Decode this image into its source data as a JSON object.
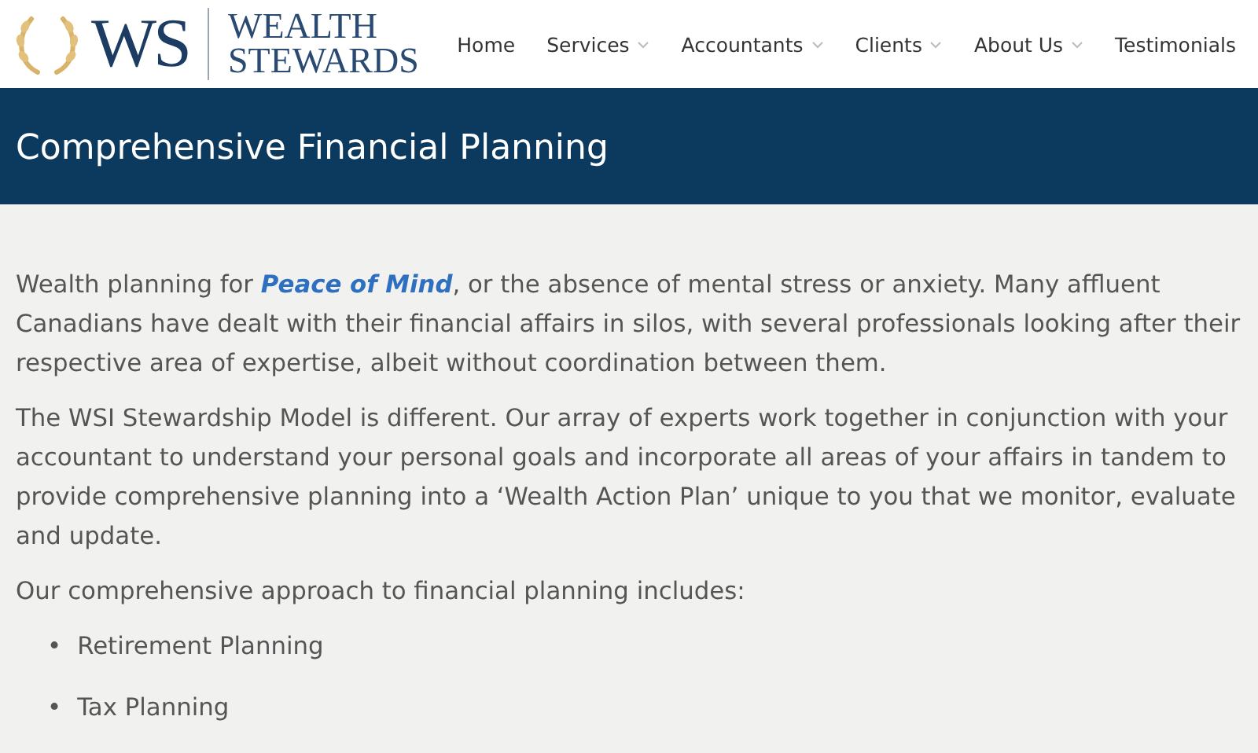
{
  "logo": {
    "monogram": "WS",
    "line_1": "WEALTH",
    "line_2": "STEWARDS"
  },
  "nav": [
    {
      "label": "Home",
      "has_dropdown": false
    },
    {
      "label": "Services",
      "has_dropdown": true
    },
    {
      "label": "Accountants",
      "has_dropdown": true
    },
    {
      "label": "Clients",
      "has_dropdown": true
    },
    {
      "label": "About Us",
      "has_dropdown": true
    },
    {
      "label": "Testimonials",
      "has_dropdown": false
    }
  ],
  "page_title": "Comprehensive Financial Planning",
  "paragraphs": [
    "Wealth planning for **Peace of Mind**, or the absence of mental stress or anxiety.  Many affluent Canadians have dealt with their financial affairs in silos, with several professionals looking after their respective area of expertise, albeit without coordination between them.",
    "The WSI Stewardship Model is different.  Our array of experts work together in conjunction with your accountant to understand your personal goals and incorporate all areas of your affairs in tandem to provide comprehensive planning into a ‘Wealth Action Plan’ unique to you that we monitor, evaluate and update.",
    "Our comprehensive approach to financial planning includes:"
  ],
  "list_items": [
    {
      "marker": "•",
      "text": "Retirement Planning"
    },
    {
      "marker": "•",
      "text": "Tax Planning"
    }
  ]
}
